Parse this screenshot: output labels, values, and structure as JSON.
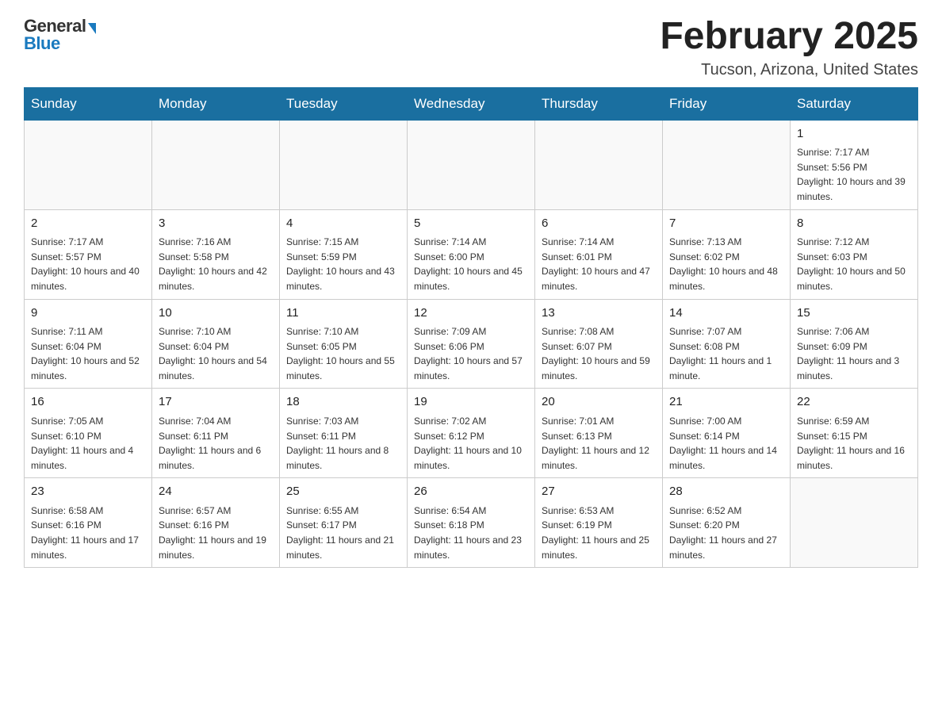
{
  "header": {
    "logo_general": "General",
    "logo_blue": "Blue",
    "month_year": "February 2025",
    "location": "Tucson, Arizona, United States"
  },
  "days_of_week": [
    "Sunday",
    "Monday",
    "Tuesday",
    "Wednesday",
    "Thursday",
    "Friday",
    "Saturday"
  ],
  "weeks": [
    [
      {
        "day": "",
        "info": ""
      },
      {
        "day": "",
        "info": ""
      },
      {
        "day": "",
        "info": ""
      },
      {
        "day": "",
        "info": ""
      },
      {
        "day": "",
        "info": ""
      },
      {
        "day": "",
        "info": ""
      },
      {
        "day": "1",
        "info": "Sunrise: 7:17 AM\nSunset: 5:56 PM\nDaylight: 10 hours and 39 minutes."
      }
    ],
    [
      {
        "day": "2",
        "info": "Sunrise: 7:17 AM\nSunset: 5:57 PM\nDaylight: 10 hours and 40 minutes."
      },
      {
        "day": "3",
        "info": "Sunrise: 7:16 AM\nSunset: 5:58 PM\nDaylight: 10 hours and 42 minutes."
      },
      {
        "day": "4",
        "info": "Sunrise: 7:15 AM\nSunset: 5:59 PM\nDaylight: 10 hours and 43 minutes."
      },
      {
        "day": "5",
        "info": "Sunrise: 7:14 AM\nSunset: 6:00 PM\nDaylight: 10 hours and 45 minutes."
      },
      {
        "day": "6",
        "info": "Sunrise: 7:14 AM\nSunset: 6:01 PM\nDaylight: 10 hours and 47 minutes."
      },
      {
        "day": "7",
        "info": "Sunrise: 7:13 AM\nSunset: 6:02 PM\nDaylight: 10 hours and 48 minutes."
      },
      {
        "day": "8",
        "info": "Sunrise: 7:12 AM\nSunset: 6:03 PM\nDaylight: 10 hours and 50 minutes."
      }
    ],
    [
      {
        "day": "9",
        "info": "Sunrise: 7:11 AM\nSunset: 6:04 PM\nDaylight: 10 hours and 52 minutes."
      },
      {
        "day": "10",
        "info": "Sunrise: 7:10 AM\nSunset: 6:04 PM\nDaylight: 10 hours and 54 minutes."
      },
      {
        "day": "11",
        "info": "Sunrise: 7:10 AM\nSunset: 6:05 PM\nDaylight: 10 hours and 55 minutes."
      },
      {
        "day": "12",
        "info": "Sunrise: 7:09 AM\nSunset: 6:06 PM\nDaylight: 10 hours and 57 minutes."
      },
      {
        "day": "13",
        "info": "Sunrise: 7:08 AM\nSunset: 6:07 PM\nDaylight: 10 hours and 59 minutes."
      },
      {
        "day": "14",
        "info": "Sunrise: 7:07 AM\nSunset: 6:08 PM\nDaylight: 11 hours and 1 minute."
      },
      {
        "day": "15",
        "info": "Sunrise: 7:06 AM\nSunset: 6:09 PM\nDaylight: 11 hours and 3 minutes."
      }
    ],
    [
      {
        "day": "16",
        "info": "Sunrise: 7:05 AM\nSunset: 6:10 PM\nDaylight: 11 hours and 4 minutes."
      },
      {
        "day": "17",
        "info": "Sunrise: 7:04 AM\nSunset: 6:11 PM\nDaylight: 11 hours and 6 minutes."
      },
      {
        "day": "18",
        "info": "Sunrise: 7:03 AM\nSunset: 6:11 PM\nDaylight: 11 hours and 8 minutes."
      },
      {
        "day": "19",
        "info": "Sunrise: 7:02 AM\nSunset: 6:12 PM\nDaylight: 11 hours and 10 minutes."
      },
      {
        "day": "20",
        "info": "Sunrise: 7:01 AM\nSunset: 6:13 PM\nDaylight: 11 hours and 12 minutes."
      },
      {
        "day": "21",
        "info": "Sunrise: 7:00 AM\nSunset: 6:14 PM\nDaylight: 11 hours and 14 minutes."
      },
      {
        "day": "22",
        "info": "Sunrise: 6:59 AM\nSunset: 6:15 PM\nDaylight: 11 hours and 16 minutes."
      }
    ],
    [
      {
        "day": "23",
        "info": "Sunrise: 6:58 AM\nSunset: 6:16 PM\nDaylight: 11 hours and 17 minutes."
      },
      {
        "day": "24",
        "info": "Sunrise: 6:57 AM\nSunset: 6:16 PM\nDaylight: 11 hours and 19 minutes."
      },
      {
        "day": "25",
        "info": "Sunrise: 6:55 AM\nSunset: 6:17 PM\nDaylight: 11 hours and 21 minutes."
      },
      {
        "day": "26",
        "info": "Sunrise: 6:54 AM\nSunset: 6:18 PM\nDaylight: 11 hours and 23 minutes."
      },
      {
        "day": "27",
        "info": "Sunrise: 6:53 AM\nSunset: 6:19 PM\nDaylight: 11 hours and 25 minutes."
      },
      {
        "day": "28",
        "info": "Sunrise: 6:52 AM\nSunset: 6:20 PM\nDaylight: 11 hours and 27 minutes."
      },
      {
        "day": "",
        "info": ""
      }
    ]
  ]
}
